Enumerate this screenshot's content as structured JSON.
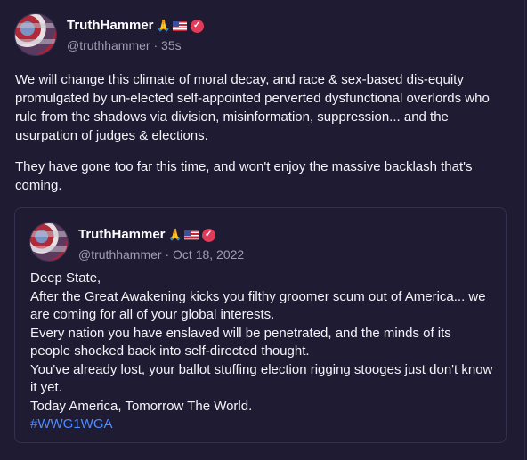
{
  "post": {
    "author_name": "TruthHammer",
    "handle": "@truthhammer",
    "time": "35s",
    "paragraphs": [
      "We will change this climate of moral decay, and race & sex-based dis-equity promulgated by un-elected self-appointed perverted dysfunctional overlords who rule from the shadows via division, misinformation, suppression... and the usurpation of judges & elections.",
      "They have gone too far this time, and won't enjoy the massive backlash that's coming."
    ]
  },
  "quote": {
    "author_name": "TruthHammer",
    "handle": "@truthhammer",
    "date": "Oct 18, 2022",
    "lines": [
      "Deep State,",
      "After the Great Awakening kicks you filthy groomer scum out of America... we are coming for all of your global interests.",
      "Every nation you have enslaved will be penetrated, and the minds of its people shocked back into self-directed thought.",
      "You've already lost, your ballot stuffing election rigging stooges just don't know it yet.",
      "Today America, Tomorrow The World."
    ],
    "hashtag": "#WWG1WGA"
  },
  "icons": {
    "pray": "🙏",
    "verified": "✓",
    "separator": "·"
  },
  "colors": {
    "background": "#1e1b33",
    "verified_badge": "#e23b5a",
    "hashtag": "#4f8cff",
    "muted_text": "#a09cb5"
  }
}
